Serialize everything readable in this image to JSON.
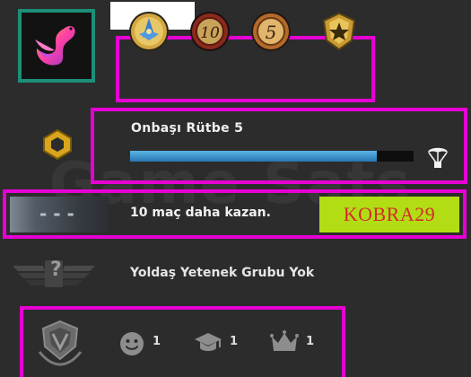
{
  "profile": {
    "avatar_icon": "pink-swan-icon",
    "name": ""
  },
  "medals": [
    {
      "icon": "blue-star-medal-icon"
    },
    {
      "icon": "ten-year-coin-icon",
      "label": "10"
    },
    {
      "icon": "five-year-coin-icon",
      "label": "5"
    },
    {
      "icon": "gold-crest-medal-icon"
    }
  ],
  "rank": {
    "title": "Onbaşı Rütbe 5",
    "progress": 0.87,
    "icon": "rank-badge-icon",
    "drop_icon": "parachute-icon"
  },
  "competitive": {
    "icon_text": "- - -",
    "message": "10 maç daha kazan.",
    "overlay_text": "KOBRA29"
  },
  "skill_group": {
    "icon": "unranked-wings-icon",
    "icon_text": "?",
    "text": "Yoldaş Yetenek Grubu Yok"
  },
  "commendations": {
    "badge_icon": "service-badge-icon",
    "friendly": {
      "icon": "smiley-icon",
      "count": "1"
    },
    "teacher": {
      "icon": "graduation-cap-icon",
      "count": "1"
    },
    "leader": {
      "icon": "crown-icon",
      "count": "1"
    }
  },
  "colors": {
    "background": "#2c2c2c",
    "highlight": "#e600d4",
    "avatar_border": "#1d8f78",
    "xp_bar": "#3c93cf",
    "overlay_bg": "#b2dd15",
    "overlay_text": "#d62a2a"
  }
}
